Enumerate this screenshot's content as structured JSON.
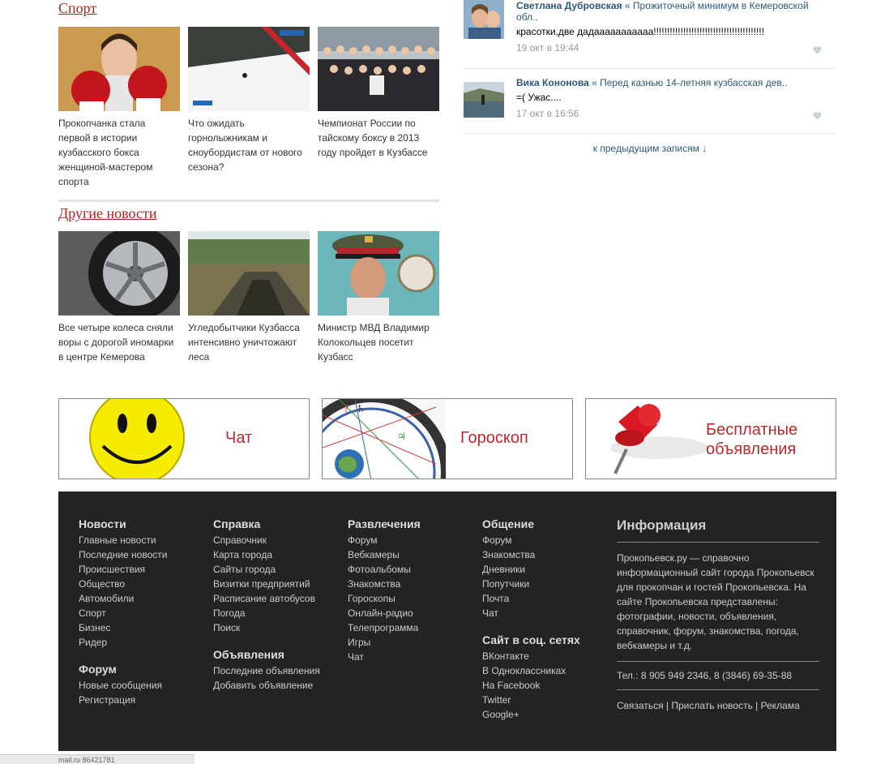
{
  "sections": {
    "sport": {
      "title": "Спорт",
      "items": [
        {
          "caption": "Прокопчанка стала первой в истории кузбасского бокса женщиной-мастером спорта"
        },
        {
          "caption": "Что ожидать горнолыжникам и сноубордистам от нового сезона?"
        },
        {
          "caption": "Чемпионат России по тайскому боксу в 2013 году пройдет в Кузбассе"
        }
      ]
    },
    "other": {
      "title": "Другие новости",
      "items": [
        {
          "caption": "Все четыре колеса сняли воры с дорогой иномарки в центре Кемерова"
        },
        {
          "caption": "Угледобытчики Кузбасса интенсивно уничтожают леса"
        },
        {
          "caption": "Министр МВД Владимир Колокольцев посетит Кузбасс"
        }
      ]
    }
  },
  "comments": [
    {
      "author": "Светлана Дубровская",
      "quote": "« Прожиточный минимум в Кемеровской обл..",
      "text": "красотки,две дадааааааааааа!!!!!!!!!!!!!!!!!!!!!!!!!!!!!!!!!!!!!!!!!",
      "date": "19 окт в 19:44"
    },
    {
      "author": "Вика Кононова",
      "quote": "« Перед казнью 14-летняя кузбасская дев..",
      "text": "=( Ужас....",
      "date": "17 окт в 16:56"
    }
  ],
  "prev_link": "к предыдущим записям ↓",
  "banners": [
    {
      "label": "Чат"
    },
    {
      "label": "Гороскоп"
    },
    {
      "label_line1": "Бесплатные",
      "label_line2": "объявления"
    }
  ],
  "footer": {
    "news": {
      "title": "Новости",
      "links": [
        "Главные новости",
        "Последние новости",
        "Происшествия",
        "Общество",
        "Автомобили",
        "Спорт",
        "Бизнес",
        "Ридер"
      ]
    },
    "forum": {
      "title": "Форум",
      "links": [
        "Новые сообщения",
        "Регистрация"
      ]
    },
    "help": {
      "title": "Справка",
      "links": [
        "Справочник",
        "Карта города",
        "Сайты города",
        "Визитки предприятий",
        "Расписание автобусов",
        "Погода",
        "Поиск"
      ]
    },
    "ads": {
      "title": "Объявления",
      "links": [
        "Последние объявления",
        "Добавить объявление"
      ]
    },
    "fun": {
      "title": "Развлечения",
      "links": [
        "Форум",
        "Вебкамеры",
        "Фотоальбомы",
        "Знакомства",
        "Гороскопы",
        "Онлайн-радио",
        "Телепрограмма",
        "Игры",
        "Чат"
      ]
    },
    "social": {
      "title": "Общение",
      "links": [
        "Форум",
        "Знакомства",
        "Дневники",
        "Попутчики",
        "Почта",
        "Чат"
      ]
    },
    "networks": {
      "title": "Сайт в соц. сетях",
      "links": [
        "ВКонтакте",
        "В Одноклассниках",
        "На Facebook",
        "Twitter",
        "Google+"
      ]
    },
    "info": {
      "title": "Информация",
      "text": "Прокопьевск.ру — справочно информационный сайт города Прокопьевск для прокопчан и гостей Прокопьевска. На сайте Прокопьевска представлены: фотографии, новости, объявления, справочник, форум, знакомства, погода, вебкамеры и т.д.",
      "phone": "Тел.: 8 905 949 2346, 8 (3846) 69-35-88",
      "link_contact": "Связаться",
      "link_news": "Прислать новость",
      "link_ads": "Реклама",
      "sep": " | "
    }
  },
  "statusbar": "mail.ru 86421781",
  "colors": {
    "accent": "#a8251c",
    "link": "#2b587a",
    "footer_bg": "#232323"
  }
}
